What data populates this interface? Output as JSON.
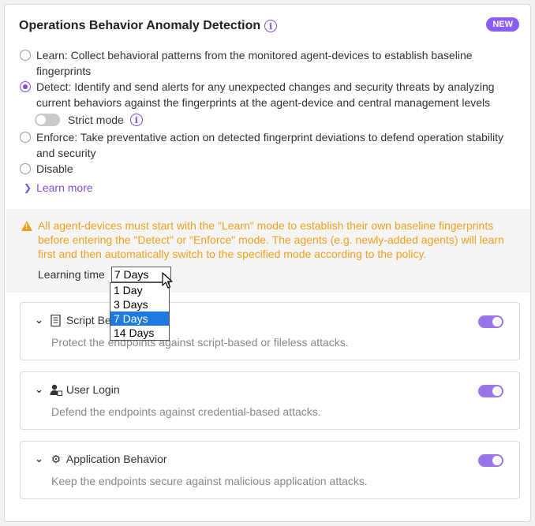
{
  "header": {
    "title": "Operations Behavior Anomaly Detection",
    "badge": "NEW"
  },
  "modes": [
    {
      "label": "Learn: Collect behavioral patterns from the monitored agent-devices to establish baseline fingerprints",
      "selected": false
    },
    {
      "label": "Detect: Identify and send alerts for any unexpected changes and security threats by analyzing current behaviors against the fingerprints at the agent-device and central management levels",
      "selected": true
    },
    {
      "label": "Enforce: Take preventative action on detected fingerprint deviations to defend operation stability and security",
      "selected": false
    },
    {
      "label": "Disable",
      "selected": false
    }
  ],
  "strict_mode": {
    "label": "Strict mode",
    "enabled": false
  },
  "learn_more": "Learn more",
  "warning": {
    "text": "All agent-devices must start with the \"Learn\" mode to establish their own baseline fingerprints before entering the \"Detect\" or \"Enforce\" mode. The agents (e.g. newly-added agents) will learn first and then automatically switch to the specified mode according to the policy.",
    "learning_time_label": "Learning time",
    "learning_time_value": "7 Days",
    "options": [
      "1 Day",
      "3 Days",
      "7 Days",
      "14 Days"
    ]
  },
  "cards": [
    {
      "title": "Script Be",
      "description": "Protect the endpoints against script-based or fileless attacks.",
      "icon": "script-icon",
      "enabled": true
    },
    {
      "title": "User Login",
      "description": "Defend the endpoints against credential-based attacks.",
      "icon": "user-login-icon",
      "enabled": true
    },
    {
      "title": "Application Behavior",
      "description": "Keep the endpoints secure against malicious application attacks.",
      "icon": "gears-icon",
      "enabled": true
    }
  ],
  "colors": {
    "accent": "#7b4ee0",
    "warning": "#f0a020",
    "selection": "#1e7ae0"
  }
}
